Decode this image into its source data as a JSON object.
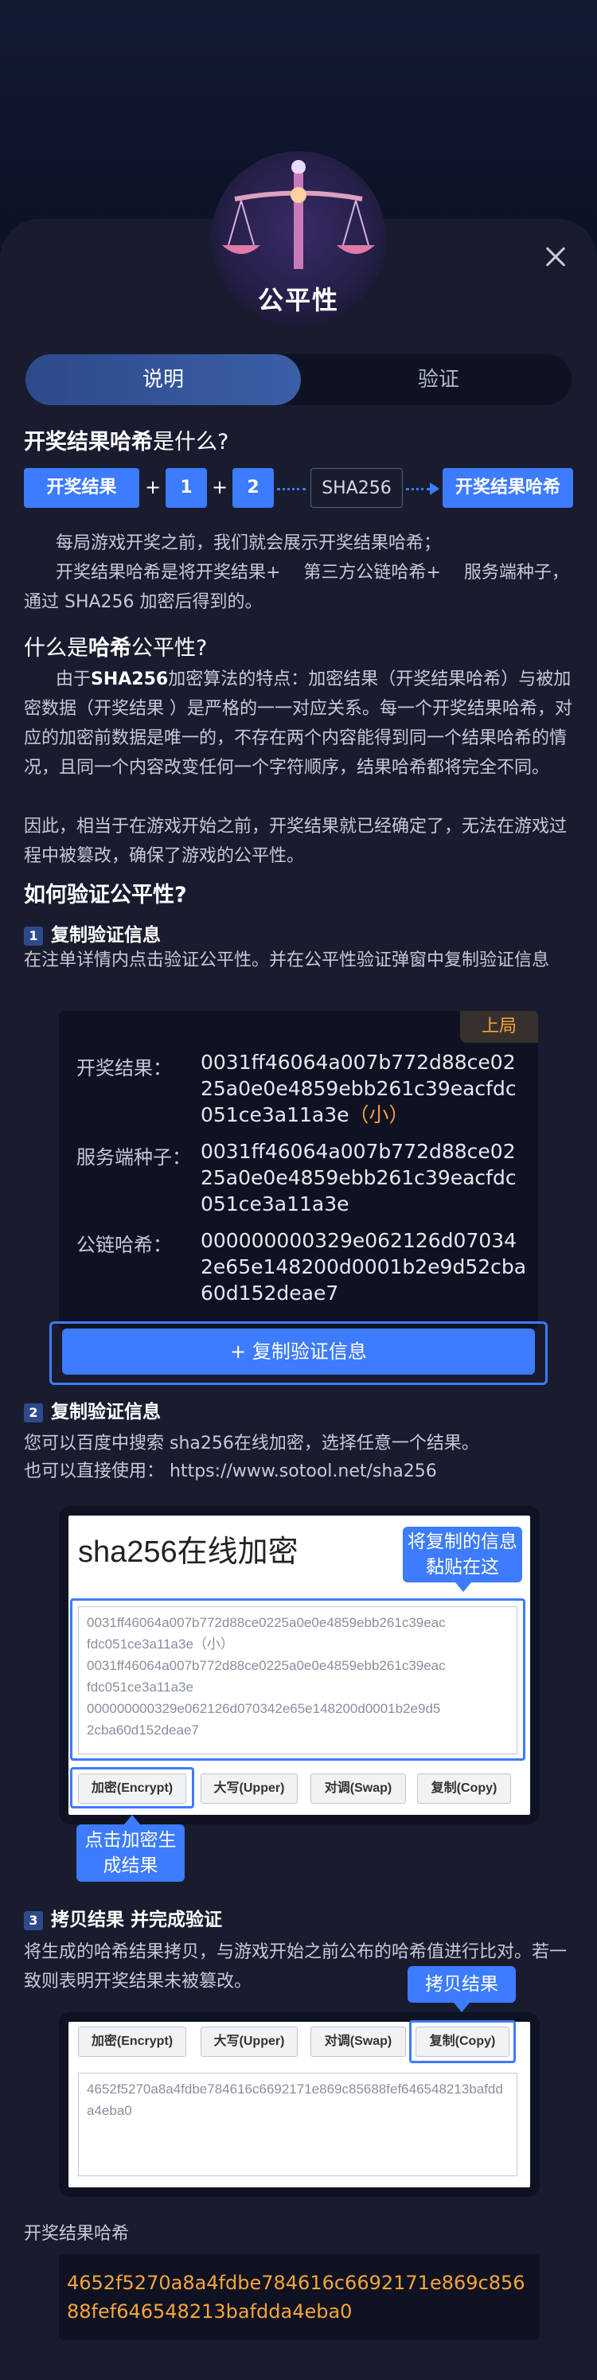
{
  "header": {
    "title": "公平性",
    "tabs": [
      "说明",
      "验证"
    ]
  },
  "section1": {
    "title_highlight": "开奖结果哈希",
    "title_rest": "是什么?",
    "flow": {
      "result": "开奖结果",
      "plus": "+",
      "one": "1",
      "two": "2",
      "sha": "SHA256",
      "hash": "开奖结果哈希"
    },
    "para1": "每局游戏开奖之前，我们就会展示开奖结果哈希；",
    "para2": "开奖结果哈希是将开奖结果+　 第三方公链哈希+　 服务端种子，通过 SHA256 加密后得到的。"
  },
  "section2": {
    "title_prefix": "什么是",
    "title_highlight": "哈希",
    "title_rest": "公平性?",
    "para_lead": "由于",
    "para_strong": "SHA256",
    "para_rest": "加密算法的特点：加密结果（开奖结果哈希）与被加密数据（开奖结果 ）是严格的一一对应关系。每一个开奖结果哈希，对应的加密前数据是唯一的，不存在两个内容能得到同一个结果哈希的情况，且同一个内容改变任何一个字符顺序，结果哈希都将完全不同。",
    "para_end": "因此，相当于在游戏开始之前，开奖结果就已经确定了，无法在游戏过程中被篡改，确保了游戏的公平性。"
  },
  "section3": {
    "title": "如何验证公平性?",
    "step1": {
      "num": "1",
      "title": "复制验证信息",
      "desc": "在注单详情内点击验证公平性。并在公平性验证弹窗中复制验证信息",
      "badge": "上局",
      "result_label": "开奖结果：",
      "result_value": "0031ff46064a007b772d88ce0225a0e0e4859ebb261c39eacfdc051ce3a11a3e",
      "result_hint": "（小）",
      "seed_label": "服务端种子：",
      "seed_value": "0031ff46064a007b772d88ce0225a0e0e4859ebb261c39eacfdc051ce3a11a3e",
      "chain_label": "公链哈希：",
      "chain_value": "000000000329e062126d070342e65e148200d0001b2e9d52cba60d152deae7",
      "copy_button": "+ 复制验证信息"
    },
    "step2": {
      "num": "2",
      "title": "复制验证信息",
      "desc1": "您可以百度中搜索 sha256在线加密，选择任意一个结果。",
      "desc2": "也可以直接使用： https://www.sotool.net/sha256",
      "tool_title": "sha256在线加密",
      "paste_callout": "将复制的信息黏贴在这",
      "input_lines": [
        "0031ff46064a007b772d88ce0225a0e0e4859ebb261c39eac",
        "fdc051ce3a11a3e（小）",
        "0031ff46064a007b772d88ce0225a0e0e4859ebb261c39eac",
        "fdc051ce3a11a3e",
        "000000000329e062126d070342e65e148200d0001b2e9d5",
        "2cba60d152deae7"
      ],
      "buttons": [
        "加密(Encrypt)",
        "大写(Upper)",
        "对调(Swap)",
        "复制(Copy)"
      ],
      "encrypt_callout": "点击加密生成结果"
    },
    "step3": {
      "num": "3",
      "title": "拷贝结果 并完成验证",
      "desc": "将生成的哈希结果拷贝，与游戏开始之前公布的哈希值进行比对。若一致则表明开奖结果未被篡改。",
      "copy_callout": "拷贝结果",
      "buttons": [
        "加密(Encrypt)",
        "大写(Upper)",
        "对调(Swap)",
        "复制(Copy)"
      ],
      "output": "4652f5270a8a4fdbe784616c6692171e869c85688fef646548213bafdda4eba0"
    },
    "final": {
      "label": "开奖结果哈希",
      "value": "4652f5270a8a4fdbe784616c6692171e869c85688fef646548213bafdda4eba0"
    }
  }
}
